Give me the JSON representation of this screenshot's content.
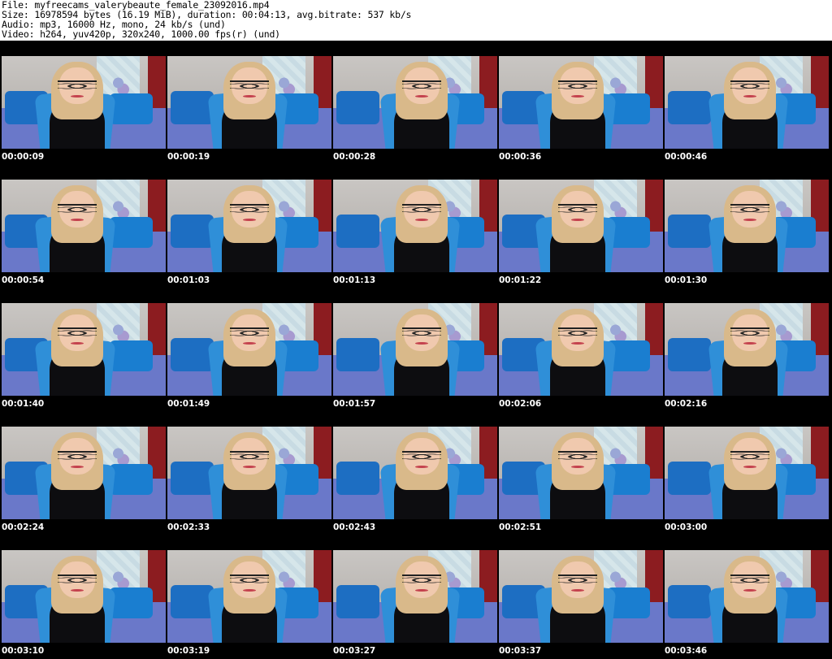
{
  "header": {
    "file_line": "File: myfreecams_valerybeaute_female_23092016.mp4",
    "size_line": "Size: 16978594 bytes (16.19 MiB), duration: 00:04:13, avg.bitrate: 537 kb/s",
    "audio_line": "Audio: mp3, 16000 Hz, mono, 24 kb/s (und)",
    "video_line": "Video: h264, yuv420p, 320x240, 1000.00 fps(r) (und)"
  },
  "thumbnails": [
    {
      "time": "00:00:09"
    },
    {
      "time": "00:00:19"
    },
    {
      "time": "00:00:28"
    },
    {
      "time": "00:00:36"
    },
    {
      "time": "00:00:46"
    },
    {
      "time": "00:00:54"
    },
    {
      "time": "00:01:03"
    },
    {
      "time": "00:01:13"
    },
    {
      "time": "00:01:22"
    },
    {
      "time": "00:01:30"
    },
    {
      "time": "00:01:40"
    },
    {
      "time": "00:01:49"
    },
    {
      "time": "00:01:57"
    },
    {
      "time": "00:02:06"
    },
    {
      "time": "00:02:16"
    },
    {
      "time": "00:02:24"
    },
    {
      "time": "00:02:33"
    },
    {
      "time": "00:02:43"
    },
    {
      "time": "00:02:51"
    },
    {
      "time": "00:03:00"
    },
    {
      "time": "00:03:10"
    },
    {
      "time": "00:03:19"
    },
    {
      "time": "00:03:27"
    },
    {
      "time": "00:03:37"
    },
    {
      "time": "00:03:46"
    }
  ],
  "colors": {
    "sheet_background": "#000000",
    "header_background": "#ffffff",
    "timestamp_text": "#ffffff"
  }
}
